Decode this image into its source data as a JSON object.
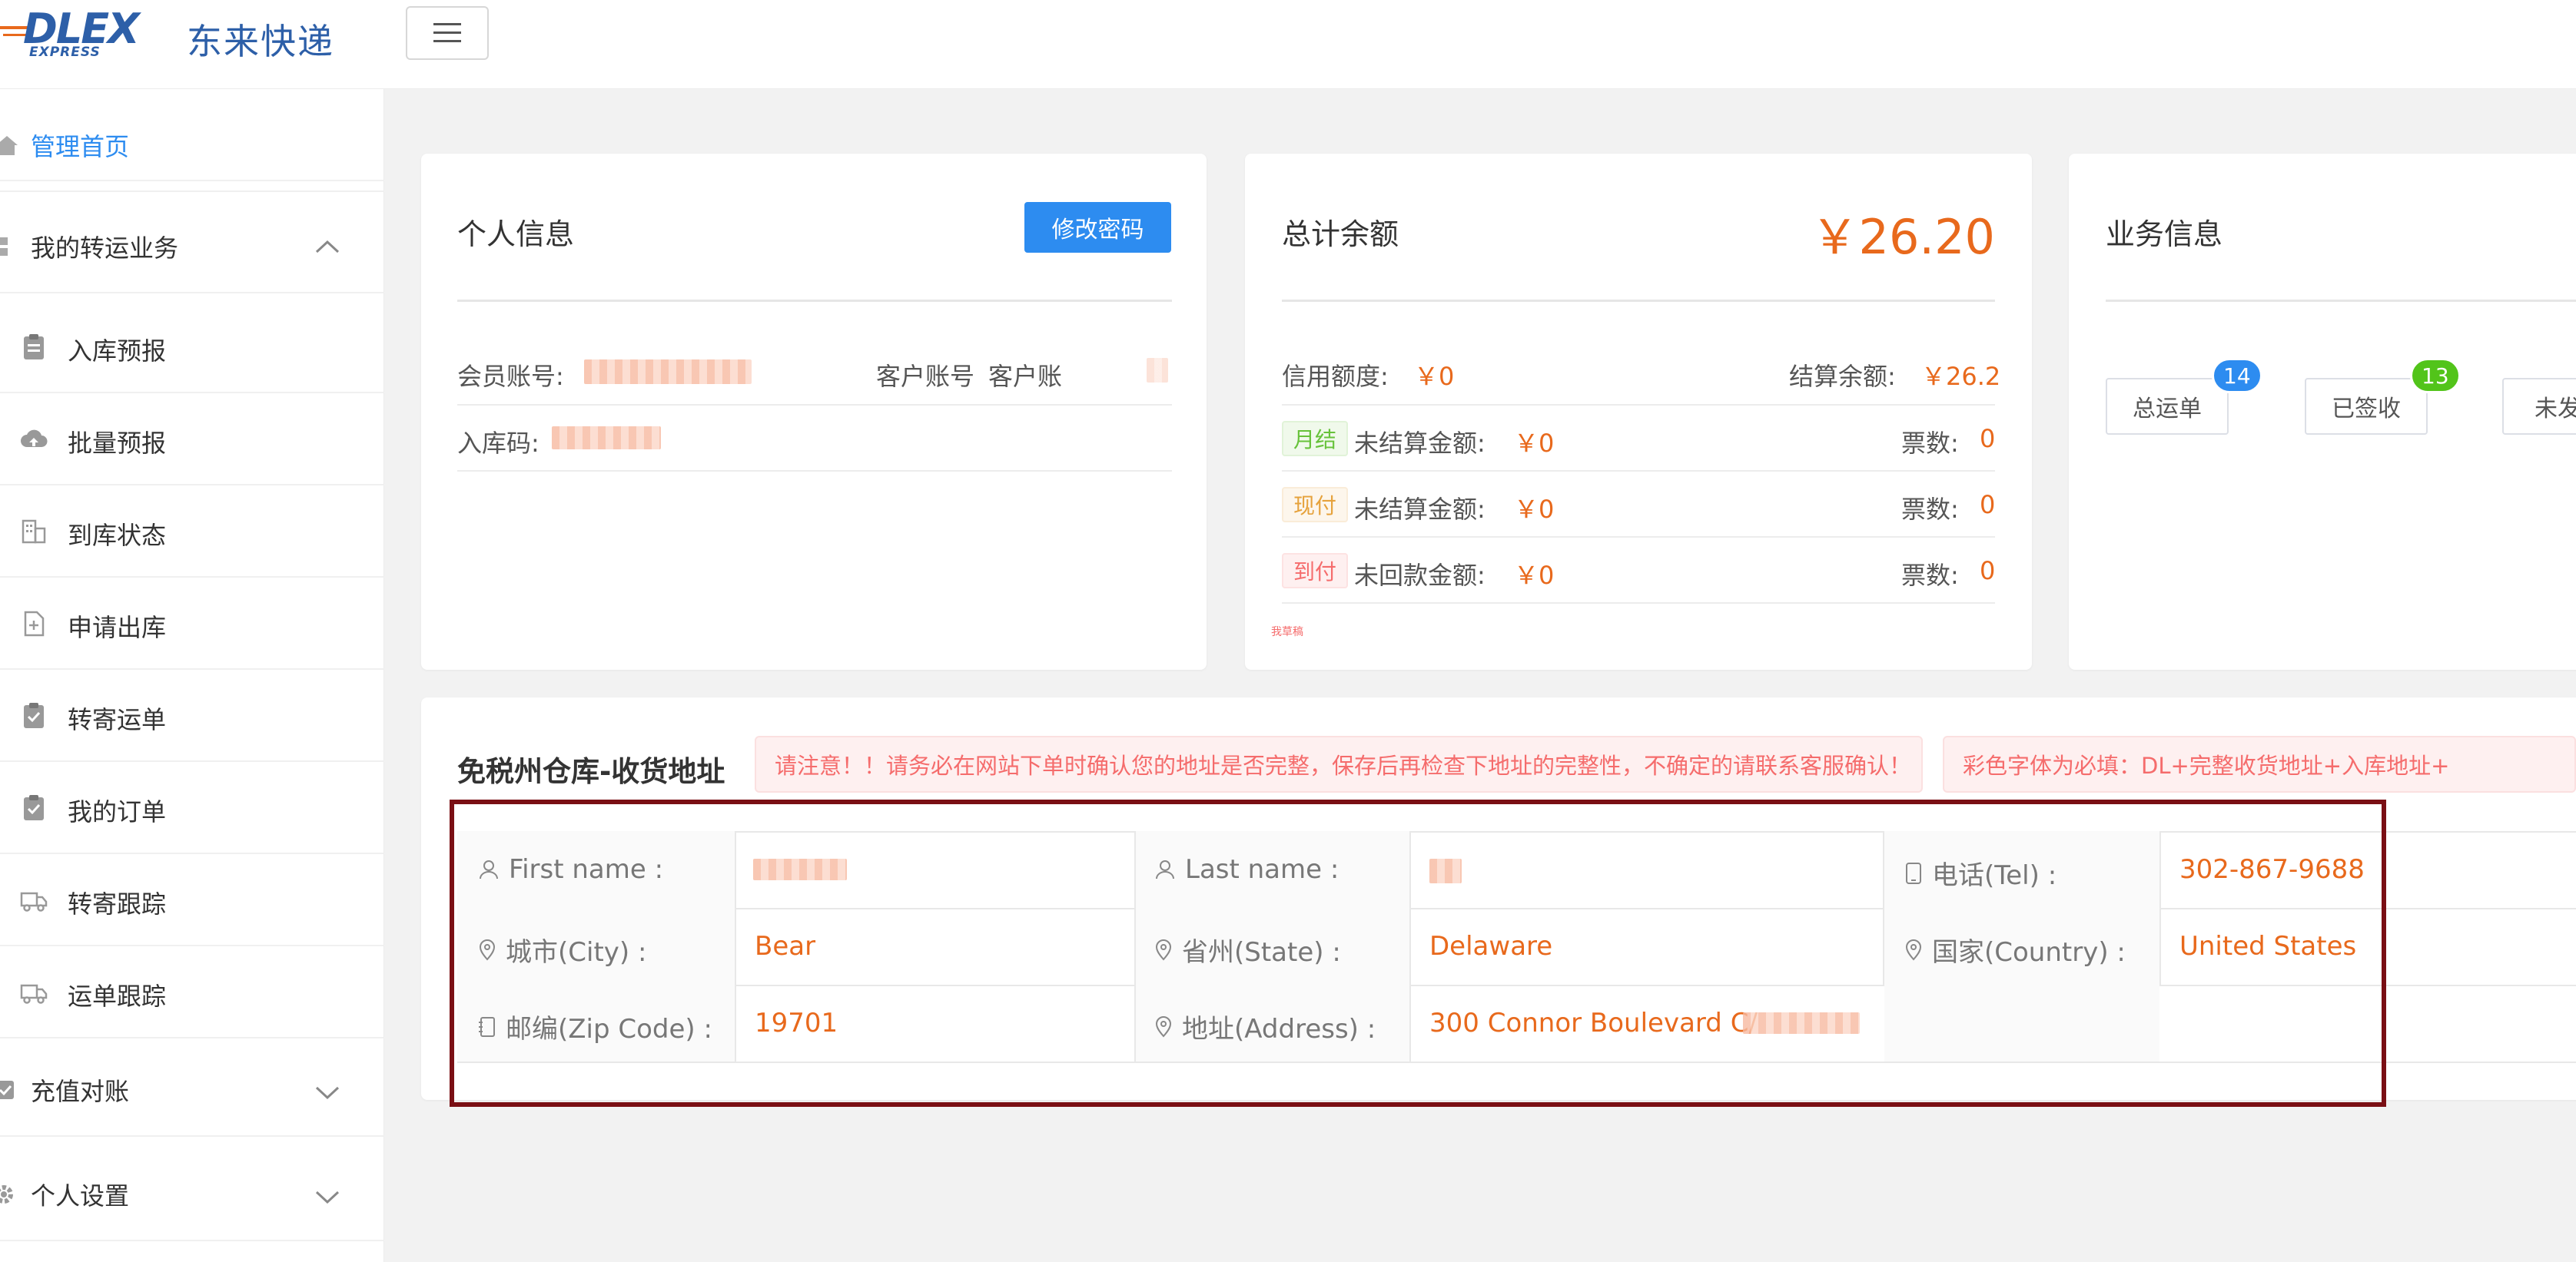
{
  "brand": {
    "logo_main": "DLEX",
    "logo_sub": "EXPRESS",
    "name": "东来快递"
  },
  "sidebar": {
    "home": "管理首页",
    "group_transfer": "我的转运业务",
    "items": [
      "入库预报",
      "批量预报",
      "到库状态",
      "申请出库",
      "转寄运单",
      "我的订单",
      "转寄跟踪",
      "运单跟踪"
    ],
    "group_recharge": "充值对账",
    "group_settings": "个人设置"
  },
  "personal": {
    "title": "个人信息",
    "change_password": "修改密码",
    "member_account_label": "会员账号:",
    "customer_account_label": "客户账号",
    "customer_account_value": "客户账",
    "warehouse_code_label": "入库码:"
  },
  "balance": {
    "title": "总计余额",
    "total": "￥26.20",
    "credit_label": "信用额度:",
    "credit_value": "￥0",
    "settle_label": "结算余额:",
    "settle_value": "￥26.2",
    "rows": [
      {
        "tag": "月结",
        "label": "未结算金额:",
        "amount": "￥0",
        "count_label": "票数:",
        "count": "0"
      },
      {
        "tag": "现付",
        "label": "未结算金额:",
        "amount": "￥0",
        "count_label": "票数:",
        "count": "0"
      },
      {
        "tag": "到付",
        "label": "未回款金额:",
        "amount": "￥0",
        "count_label": "票数:",
        "count": "0"
      }
    ],
    "footnote": "我草稿"
  },
  "business": {
    "title": "业务信息",
    "buttons": [
      {
        "label": "总运单",
        "count": "14",
        "color": "#2d8cf0"
      },
      {
        "label": "已签收",
        "count": "13",
        "color": "#52c41a"
      },
      {
        "label": "未发"
      }
    ]
  },
  "address": {
    "title": "免税州仓库-收货地址",
    "warning1": "请注意！！请务必在网站下单时确认您的地址是否完整，保存后再检查下地址的完整性，不确定的请联系客服确认！",
    "warning2": "彩色字体为必填：DL+完整收货地址+入库地址+",
    "first_name_label": "First name :",
    "last_name_label": "Last name :",
    "tel_label": "电话(Tel) :",
    "tel_value": "302-867-9688",
    "city_label": "城市(City) :",
    "city_value": "Bear",
    "state_label": "省州(State) :",
    "state_value": "Delaware",
    "country_label": "国家(Country) :",
    "country_value": "United States",
    "zip_label": "邮编(Zip Code) :",
    "zip_value": "19701",
    "address_label": "地址(Address) :",
    "address_value": "300 Connor Boulevard C/"
  },
  "colors": {
    "accent": "#2d8cf0",
    "value_orange": "#e8691c",
    "highlight_box": "#7a0f14"
  }
}
